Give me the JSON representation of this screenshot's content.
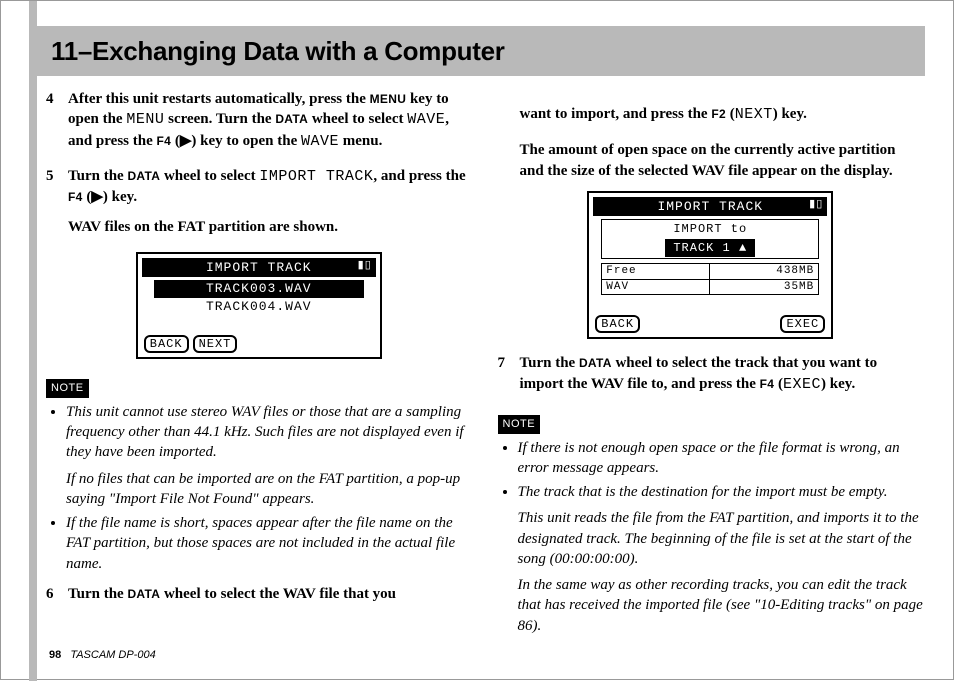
{
  "title": "11–Exchanging Data with a Computer",
  "footer": {
    "page": "98",
    "model": "TASCAM  DP-004"
  },
  "left": {
    "step4": {
      "num": "4",
      "t1": "After this unit restarts automatically, press the ",
      "menu_key": "MENU",
      "t2": " key to open the ",
      "menu_mono": "MENU",
      "t3": " screen. Turn the ",
      "data_key": "DATA",
      "t4": " wheel to select ",
      "wave1": "WAVE",
      "t5": ", and press the ",
      "f4": "F4",
      "t6": " (",
      "play": "▶",
      "t7": ") key to open the ",
      "wave2": "WAVE",
      "t8": " menu."
    },
    "step5": {
      "num": "5",
      "t1": "Turn the ",
      "data_key": "DATA",
      "t2": " wheel to select ",
      "import": "IMPORT TRACK",
      "t3": ", and press the ",
      "f4": "F4",
      "t4": " (",
      "play": "▶",
      "t5": ") key.",
      "sub": "WAV files on the FAT partition are shown."
    },
    "lcd1": {
      "hdr": "IMPORT TRACK",
      "sel": "TRACK003.WAV",
      "line": "TRACK004.WAV",
      "back": "BACK",
      "next": "NEXT"
    },
    "note_label": "NOTE",
    "notes": {
      "n1a": "This unit cannot use stereo WAV files or those that are a sampling frequency other than 44.1 kHz. Such files are not displayed even if they have been imported.",
      "n1b": "If no files that can be imported are on the FAT partition, a pop-up saying \"Import File Not Found\" appears.",
      "n2": "If the file name is short, spaces appear after the file name on the FAT partition, but those spaces are not included in the actual file name."
    },
    "step6": {
      "num": "6",
      "t1": "Turn the ",
      "data_key": "DATA",
      "t2": " wheel to select the WAV file that you"
    }
  },
  "right": {
    "cont": {
      "t1": "want to import, and press the ",
      "f2": "F2",
      "t2": " (",
      "next": "NEXT",
      "t3": ") key."
    },
    "para": "The amount of open space on the currently active partition and the size of the selected WAV file appear on the display.",
    "lcd2": {
      "hdr": "IMPORT TRACK",
      "line1": "IMPORT to",
      "track": "TRACK 1",
      "free_l": "Free",
      "free_v": "438MB",
      "wav_l": "WAV",
      "wav_v": "35MB",
      "back": "BACK",
      "exec": "EXEC"
    },
    "step7": {
      "num": "7",
      "t1": "Turn the ",
      "data_key": "DATA",
      "t2": " wheel to select the track that you want to import the WAV file to, and press the ",
      "f4": "F4",
      "t3": " (",
      "exec": "EXEC",
      "t4": ") key."
    },
    "note_label": "NOTE",
    "notes": {
      "n1": "If there is not enough open space or the file format is wrong, an error message appears.",
      "n2a": "The track that is the destination for the import must be empty.",
      "n2b": "This unit reads the file from the FAT partition, and imports it to the designated track. The beginning of the file is set at the start of the song (00:00:00:00).",
      "n2c": "In the same way as other recording tracks, you can edit the track that has received the imported file (see \"10-Editing tracks\" on page 86)."
    }
  }
}
